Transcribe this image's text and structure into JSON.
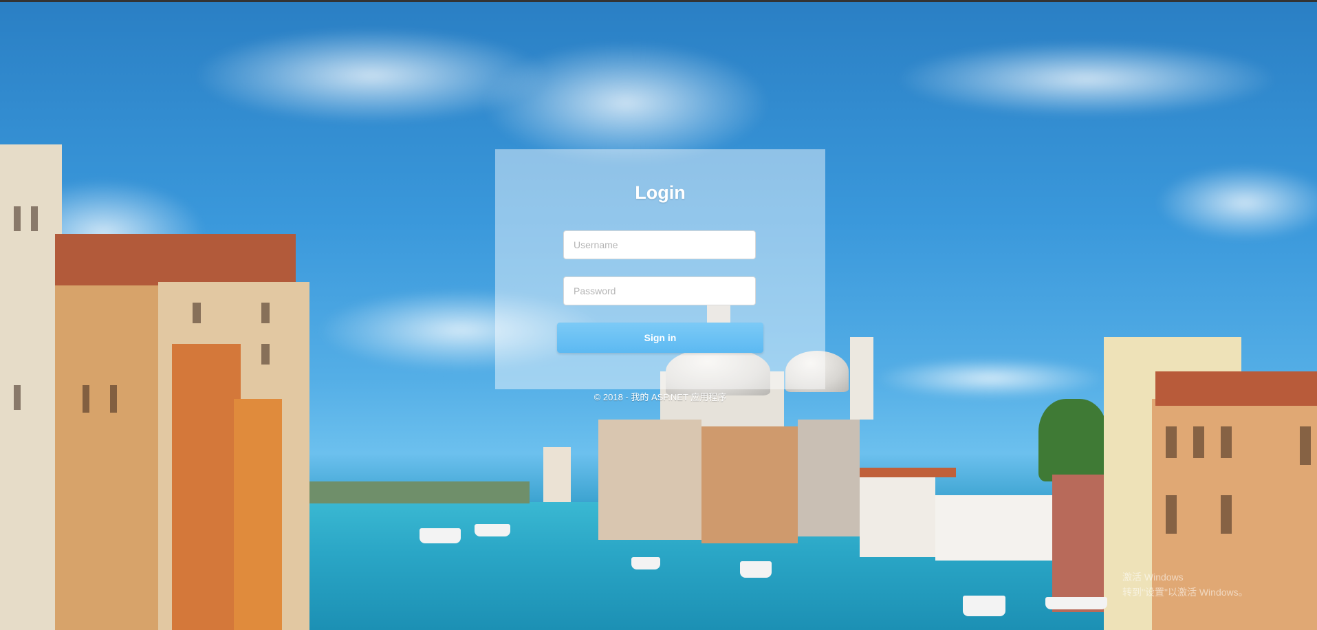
{
  "login": {
    "title": "Login",
    "username_placeholder": "Username",
    "password_placeholder": "Password",
    "signin_label": "Sign in"
  },
  "footer": {
    "text": "© 2018 - 我的 ASP.NET 应用程序"
  },
  "watermark": {
    "line1": "激活 Windows",
    "line2": "转到\"设置\"以激活 Windows。"
  },
  "colors": {
    "panel_bg": "rgba(255,255,255,0.45)",
    "button_accent": "#5cb9f2",
    "title_text": "#ffffff"
  }
}
